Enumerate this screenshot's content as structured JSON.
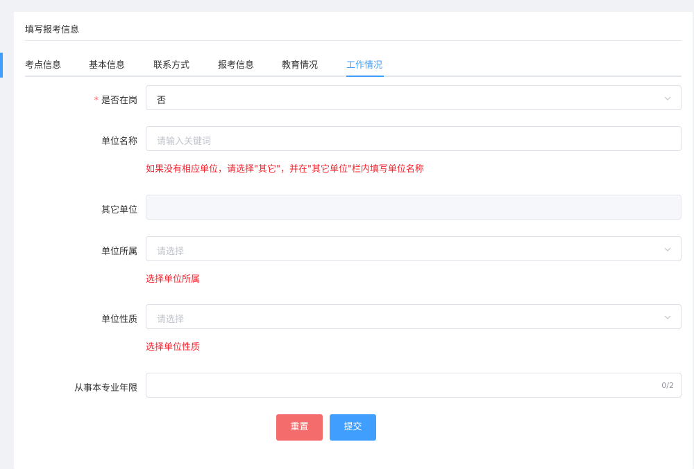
{
  "page": {
    "title": "填写报考信息"
  },
  "tabs": [
    {
      "label": "考点信息"
    },
    {
      "label": "基本信息"
    },
    {
      "label": "联系方式"
    },
    {
      "label": "报考信息"
    },
    {
      "label": "教育情况"
    },
    {
      "label": "工作情况"
    }
  ],
  "active_tab": "工作情况",
  "form": {
    "on_duty": {
      "required_mark": "*",
      "label": "是否在岗",
      "value": "否"
    },
    "unit_name": {
      "label": "单位名称",
      "placeholder": "请输入关键词",
      "hint": "如果没有相应单位，请选择\"其它\"，并在\"其它单位\"栏内填写单位名称"
    },
    "other_unit": {
      "label": "其它单位",
      "value": ""
    },
    "unit_affiliation": {
      "label": "单位所属",
      "placeholder": "请选择",
      "hint": "选择单位所属"
    },
    "unit_nature": {
      "label": "单位性质",
      "placeholder": "请选择",
      "hint": "选择单位性质"
    },
    "years_in_profession": {
      "label": "从事本专业年限",
      "value": "",
      "counter": "0/2"
    }
  },
  "buttons": {
    "reset": "重置",
    "submit": "提交"
  },
  "colors": {
    "primary": "#409eff",
    "danger": "#f56c6c",
    "hint_red": "#f5222d"
  }
}
